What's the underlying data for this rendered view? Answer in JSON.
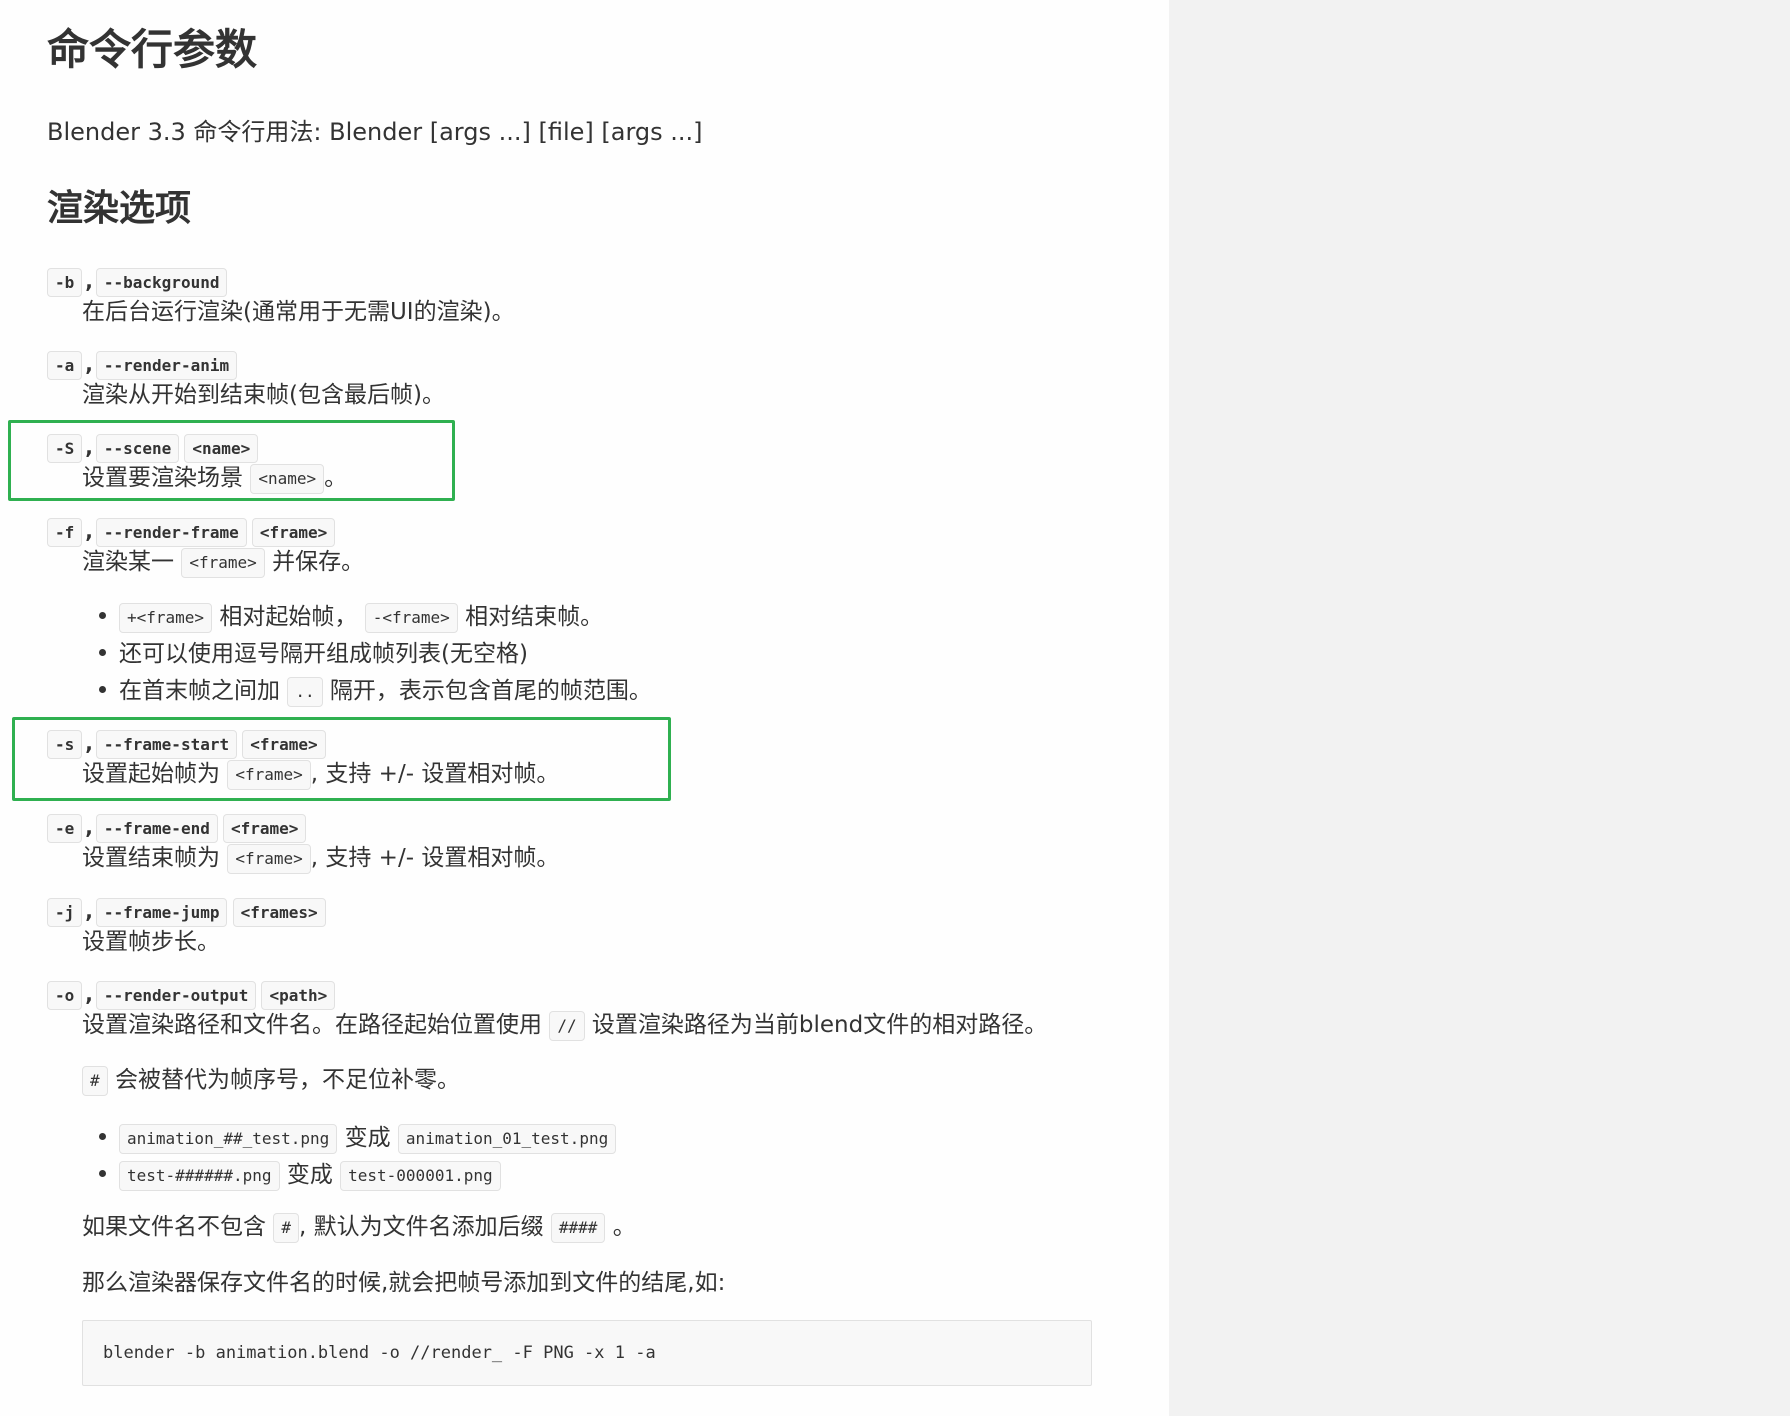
{
  "title": "命令行参数",
  "usage": "Blender 3.3 命令行用法: Blender [args ...] [file] [args ...]",
  "section_title": "渲染选项",
  "options": {
    "background": {
      "short": "-b",
      "comma": ",",
      "long": "--background",
      "desc": "在后台运行渲染(通常用于无需UI的渲染)。"
    },
    "render_anim": {
      "short": "-a",
      "comma": ",",
      "long": "--render-anim",
      "desc": "渲染从开始到结束帧(包含最后帧)。"
    },
    "scene": {
      "short": "-S",
      "comma": ",",
      "long": "--scene",
      "arg": "<name>",
      "desc_pre": "设置要渲染场景",
      "desc_code": "<name>",
      "desc_post": "。"
    },
    "render_frame": {
      "short": "-f",
      "comma": ",",
      "long": "--render-frame",
      "arg": "<frame>",
      "desc_pre": "渲染某一",
      "desc_code": "<frame>",
      "desc_post": "并保存。",
      "bullets": {
        "b1_code1": "+<frame>",
        "b1_text1": "相对起始帧，",
        "b1_code2": "-<frame>",
        "b1_text2": "相对结束帧。",
        "b2_text": "还可以使用逗号隔开组成帧列表(无空格)",
        "b3_pre": "在首末帧之间加",
        "b3_code": "..",
        "b3_post": "隔开，表示包含首尾的帧范围。"
      }
    },
    "frame_start": {
      "short": "-s",
      "comma": ",",
      "long": "--frame-start",
      "arg": "<frame>",
      "desc_pre": "设置起始帧为",
      "desc_code": "<frame>",
      "desc_post": ", 支持 +/- 设置相对帧。"
    },
    "frame_end": {
      "short": "-e",
      "comma": ",",
      "long": "--frame-end",
      "arg": "<frame>",
      "desc_pre": "设置结束帧为",
      "desc_code": "<frame>",
      "desc_post": ", 支持 +/- 设置相对帧。"
    },
    "frame_jump": {
      "short": "-j",
      "comma": ",",
      "long": "--frame-jump",
      "arg": "<frames>",
      "desc": "设置帧步长。"
    },
    "render_output": {
      "short": "-o",
      "comma": ",",
      "long": "--render-output",
      "arg": "<path>",
      "desc_pre": "设置渲染路径和文件名。在路径起始位置使用",
      "desc_code": "//",
      "desc_post": "设置渲染路径为当前blend文件的相对路径。",
      "hash_code": "#",
      "hash_text": "会被替代为帧序号，不足位补零。",
      "ex1_code1": "animation_##_test.png",
      "ex1_text": "变成",
      "ex1_code2": "animation_01_test.png",
      "ex2_code1": "test-######.png",
      "ex2_text": "变成",
      "ex2_code2": "test-000001.png",
      "nohash_pre": "如果文件名不包含",
      "nohash_code": "#",
      "nohash_mid": ", 默认为文件名添加后缀",
      "nohash_code2": "####",
      "nohash_post": "。",
      "save_note": "那么渲染器保存文件名的时候,就会把帧号添加到文件的结尾,如:",
      "example_cmd": "blender -b animation.blend -o //render_ -F PNG -x 1 -a"
    }
  },
  "colors": {
    "highlight_border": "#2fb050",
    "page_bg": "#fefefe",
    "side_bg": "#f2f2f2",
    "code_bg": "#f8f8f8",
    "code_border": "#e1e1e1",
    "text": "#333333"
  }
}
